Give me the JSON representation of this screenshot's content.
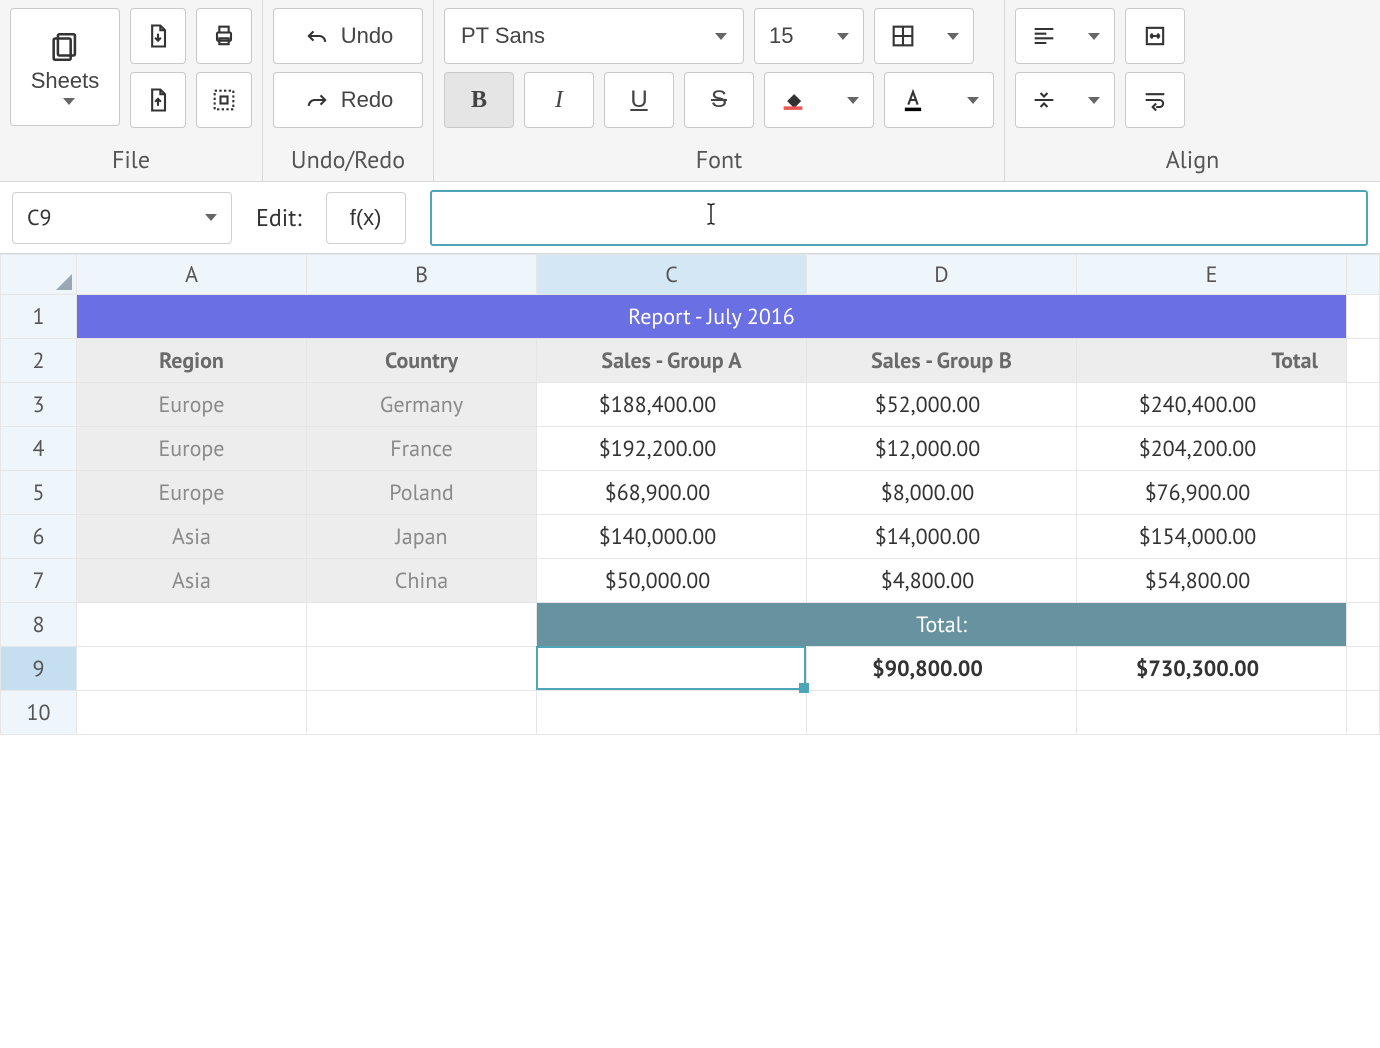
{
  "toolbar": {
    "groups": {
      "file": {
        "label": "File",
        "sheets_label": "Sheets"
      },
      "undoredo": {
        "label": "Undo/Redo",
        "undo_label": "Undo",
        "redo_label": "Redo"
      },
      "font": {
        "label": "Font",
        "font_name": "PT Sans",
        "font_size": "15"
      },
      "align": {
        "label": "Align"
      }
    }
  },
  "formula_bar": {
    "edit_label": "Edit:",
    "fx_label": "f(x)",
    "cell_ref": "C9",
    "input_value": ""
  },
  "columns": [
    "A",
    "B",
    "C",
    "D",
    "E"
  ],
  "sheet": {
    "title": "Report - July 2016",
    "headers": [
      "Region",
      "Country",
      "Sales - Group A",
      "Sales - Group B",
      "Total"
    ],
    "rows": [
      {
        "region": "Europe",
        "country": "Germany",
        "a": "$188,400.00",
        "b": "$52,000.00",
        "total": "$240,400.00"
      },
      {
        "region": "Europe",
        "country": "France",
        "a": "$192,200.00",
        "b": "$12,000.00",
        "total": "$204,200.00"
      },
      {
        "region": "Europe",
        "country": "Poland",
        "a": "$68,900.00",
        "b": "$8,000.00",
        "total": "$76,900.00"
      },
      {
        "region": "Asia",
        "country": "Japan",
        "a": "$140,000.00",
        "b": "$14,000.00",
        "total": "$154,000.00"
      },
      {
        "region": "Asia",
        "country": "China",
        "a": "$50,000.00",
        "b": "$4,800.00",
        "total": "$54,800.00"
      }
    ],
    "total_label": "Total:",
    "grand_b": "$90,800.00",
    "grand_total": "$730,300.00"
  }
}
